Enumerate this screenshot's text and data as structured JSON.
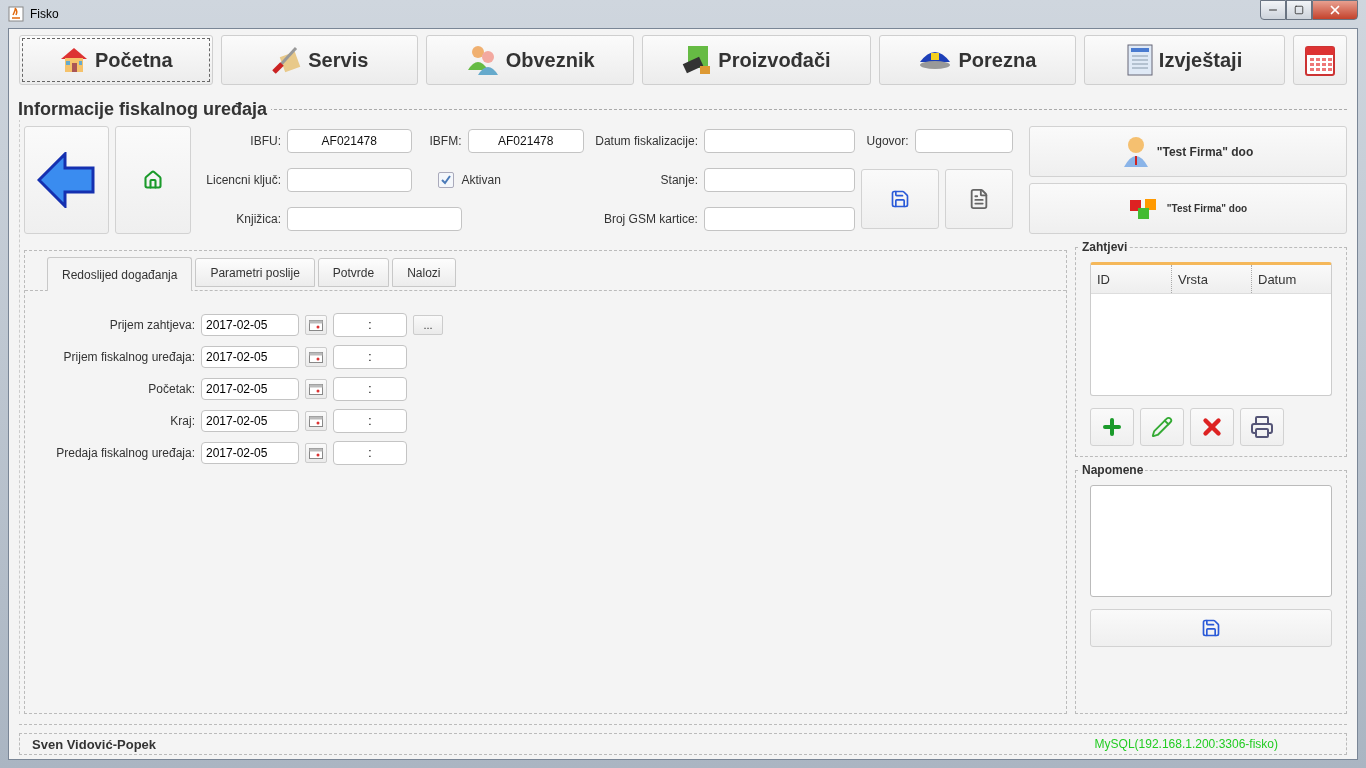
{
  "window": {
    "title": "Fisko"
  },
  "nav": [
    {
      "label": "Početna",
      "selected": true
    },
    {
      "label": "Servis",
      "selected": false
    },
    {
      "label": "Obveznik",
      "selected": false
    },
    {
      "label": "Proizvođači",
      "selected": false
    },
    {
      "label": "Porezna",
      "selected": false
    },
    {
      "label": "Izvještaji",
      "selected": false
    }
  ],
  "section": {
    "title": "Informacije fiskalnog uređaja"
  },
  "fields": [
    {
      "kind": "field",
      "label": "IBFU:",
      "value": "AF021478"
    },
    {
      "kind": "field",
      "label": "IBFM:",
      "value": "AF021478"
    },
    {
      "kind": "field",
      "label": "Datum fiskalizacije:"
    },
    {
      "kind": "field",
      "label": "Ugovor:"
    },
    {
      "kind": "field",
      "label": "Licencni ključ:"
    },
    {
      "kind": "checkbox",
      "label": "Aktivan",
      "checked": true
    },
    {
      "kind": "field",
      "label": "Stanje:"
    },
    {
      "kind": "field",
      "label": "Knjižica:"
    },
    {
      "kind": "field",
      "label": "Broj GSM kartice:"
    }
  ],
  "firm_buttons": [
    {
      "label": "\"Test Firma\" doo"
    },
    {
      "label": "\"Test Firma\" doo"
    }
  ],
  "tabs": [
    {
      "label": "Redoslijed događanja",
      "selected": true
    },
    {
      "label": "Parametri poslije",
      "selected": false
    },
    {
      "label": "Potvrde",
      "selected": false
    },
    {
      "label": "Nalozi",
      "selected": false
    }
  ],
  "events": [
    {
      "label": "Prijem zahtjeva:",
      "date": "2017-02-05",
      "time": ":",
      "more_button": "..."
    },
    {
      "label": "Prijem fiskalnog uređaja:",
      "date": "2017-02-05",
      "time": ":"
    },
    {
      "label": "Početak:",
      "date": "2017-02-05",
      "time": ":"
    },
    {
      "label": "Kraj:",
      "date": "2017-02-05",
      "time": ":"
    },
    {
      "label": "Predaja fiskalnog uređaja:",
      "date": "2017-02-05",
      "time": ":"
    }
  ],
  "requests": {
    "title": "Zahtjevi",
    "columns": [
      "ID",
      "Vrsta",
      "Datum"
    ],
    "actions": [
      {
        "kind": "add"
      },
      {
        "kind": "edit"
      },
      {
        "kind": "delete"
      },
      {
        "kind": "print"
      }
    ]
  },
  "notes": {
    "title": "Napomene"
  },
  "status_bar": {
    "user": "Sven Vidović-Popek",
    "connection": "MySQL(192.168.1.200:3306-fisko)"
  }
}
